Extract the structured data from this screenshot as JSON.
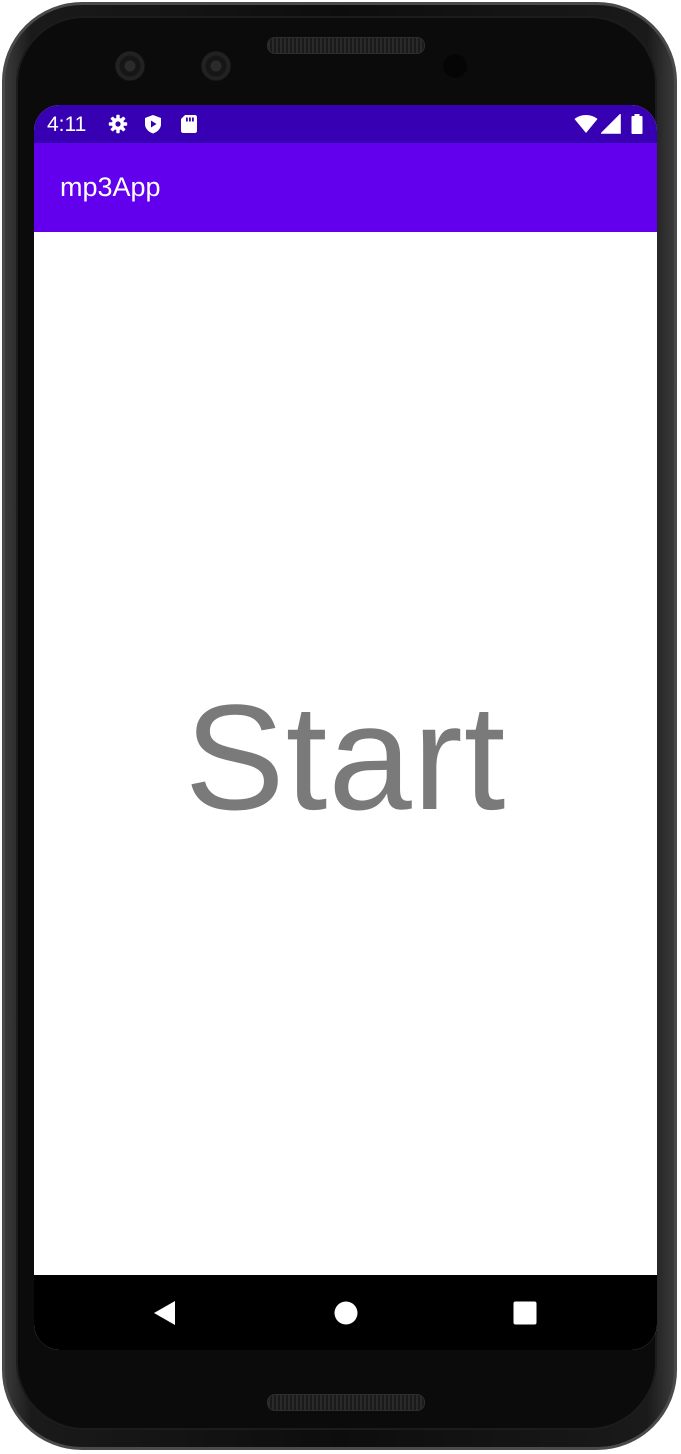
{
  "status_bar": {
    "time": "4:11",
    "icons_left": [
      "gear-icon",
      "shield-play-icon",
      "sd-card-icon"
    ],
    "icons_right": [
      "wifi-icon",
      "cell-signal-icon",
      "battery-icon"
    ],
    "color": "#3700b3"
  },
  "app_bar": {
    "title": "mp3App",
    "color": "#6200ee"
  },
  "main": {
    "start_label": "Start",
    "text_color": "#7a7a7a"
  },
  "nav_bar": {
    "buttons": [
      "back-icon",
      "home-icon",
      "recents-icon"
    ]
  }
}
